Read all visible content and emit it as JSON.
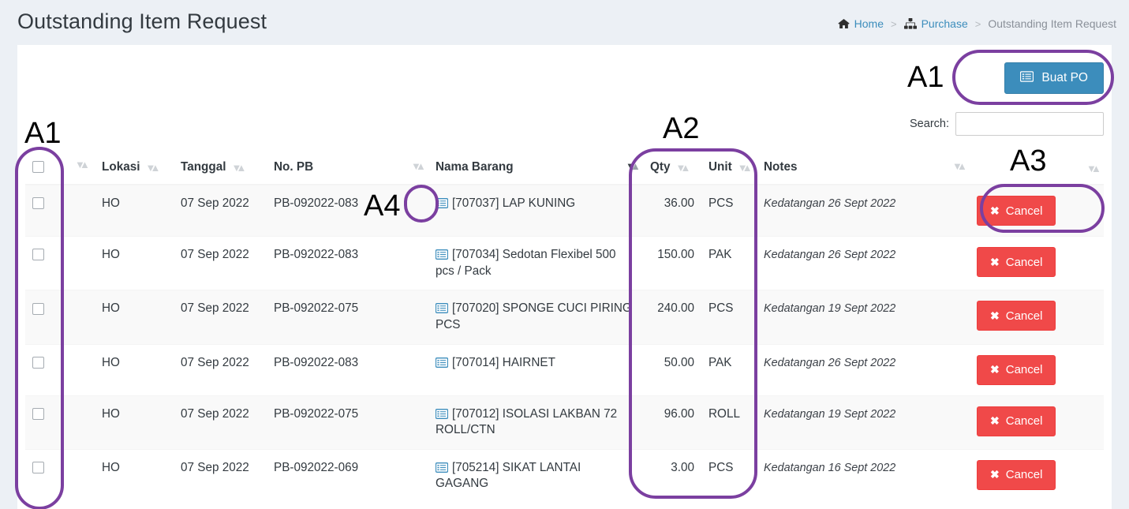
{
  "header": {
    "title": "Outstanding Item Request",
    "breadcrumb": {
      "home": "Home",
      "purchase": "Purchase",
      "current": "Outstanding Item Request",
      "separator": ">"
    }
  },
  "toolbar": {
    "buat_po_label": "Buat PO",
    "buat_po_icon": "list-alt-icon",
    "buat_po_color": "#3c8dbc"
  },
  "search": {
    "label": "Search:",
    "value": "",
    "placeholder": ""
  },
  "table": {
    "columns": {
      "select_all": "",
      "lokasi": "Lokasi",
      "tanggal": "Tanggal",
      "no_pb": "No. PB",
      "nama_barang": "Nama Barang",
      "qty": "Qty",
      "unit": "Unit",
      "notes": "Notes",
      "actions": ""
    },
    "sort_active_column": "Nama Barang",
    "rows": [
      {
        "lokasi": "HO",
        "tanggal": "07 Sep 2022",
        "no_pb": "PB-092022-083",
        "nama_barang": "[707037] LAP KUNING",
        "qty": "36.00",
        "unit": "PCS",
        "notes": "Kedatangan 26 Sept 2022",
        "action": "Cancel"
      },
      {
        "lokasi": "HO",
        "tanggal": "07 Sep 2022",
        "no_pb": "PB-092022-083",
        "nama_barang": "[707034] Sedotan Flexibel 500 pcs / Pack",
        "qty": "150.00",
        "unit": "PAK",
        "notes": "Kedatangan 26 Sept 2022",
        "action": "Cancel"
      },
      {
        "lokasi": "HO",
        "tanggal": "07 Sep 2022",
        "no_pb": "PB-092022-075",
        "nama_barang": "[707020] SPONGE CUCI PIRING PCS",
        "qty": "240.00",
        "unit": "PCS",
        "notes": "Kedatangan 19 Sept 2022",
        "action": "Cancel"
      },
      {
        "lokasi": "HO",
        "tanggal": "07 Sep 2022",
        "no_pb": "PB-092022-083",
        "nama_barang": "[707014] HAIRNET",
        "qty": "50.00",
        "unit": "PAK",
        "notes": "Kedatangan 26 Sept 2022",
        "action": "Cancel"
      },
      {
        "lokasi": "HO",
        "tanggal": "07 Sep 2022",
        "no_pb": "PB-092022-075",
        "nama_barang": "[707012] ISOLASI LAKBAN 72 ROLL/CTN",
        "qty": "96.00",
        "unit": "ROLL",
        "notes": "Kedatangan 19 Sept 2022",
        "action": "Cancel"
      },
      {
        "lokasi": "HO",
        "tanggal": "07 Sep 2022",
        "no_pb": "PB-092022-069",
        "nama_barang": "[705214] SIKAT LANTAI GAGANG",
        "qty": "3.00",
        "unit": "PCS",
        "notes": "Kedatangan 16 Sept 2022",
        "action": "Cancel"
      }
    ]
  },
  "annotations": {
    "color": "#7b3fa0",
    "labels": {
      "a1_button": "A1",
      "a1_checkbox": "A1",
      "a2": "A2",
      "a3": "A3",
      "a4": "A4"
    }
  }
}
